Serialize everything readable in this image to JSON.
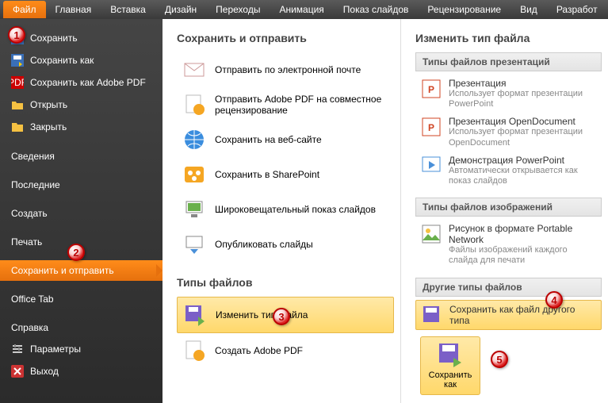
{
  "tabs": [
    "Файл",
    "Главная",
    "Вставка",
    "Дизайн",
    "Переходы",
    "Анимация",
    "Показ слайдов",
    "Рецензирование",
    "Вид",
    "Разработ"
  ],
  "sidebar": {
    "save": "Сохранить",
    "saveas": "Сохранить как",
    "savepdf": "Сохранить как Adobe PDF",
    "open": "Открыть",
    "close": "Закрыть",
    "info": "Сведения",
    "recent": "Последние",
    "new": "Создать",
    "print": "Печать",
    "share": "Сохранить и отправить",
    "officetab": "Office Tab",
    "help": "Справка",
    "options": "Параметры",
    "exit": "Выход"
  },
  "col1": {
    "h": "Сохранить и отправить",
    "items": [
      "Отправить по электронной почте",
      "Отправить Adobe PDF на совместное рецензирование",
      "Сохранить на веб-сайте",
      "Сохранить в SharePoint",
      "Широковещательный показ слайдов",
      "Опубликовать слайды"
    ],
    "h2": "Типы файлов",
    "items2": [
      "Изменить тип файла",
      "Создать Adobe PDF"
    ]
  },
  "col2": {
    "h": "Изменить тип файла",
    "sec1": "Типы файлов презентаций",
    "ft1": [
      {
        "t": "Презентация",
        "d": "Использует формат презентации PowerPoint"
      },
      {
        "t": "Презентация OpenDocument",
        "d": "Использует формат презентации OpenDocument"
      },
      {
        "t": "Демонстрация PowerPoint",
        "d": "Автоматически открывается как показ слайдов"
      }
    ],
    "sec2": "Типы файлов изображений",
    "ft2": [
      {
        "t": "Рисунок в формате Portable Network",
        "d": "Файлы изображений каждого слайда для печати"
      }
    ],
    "sec3": "Другие типы файлов",
    "ft3": [
      {
        "t": "Сохранить как файл другого типа",
        "d": ""
      }
    ],
    "btn": "Сохранить как"
  }
}
